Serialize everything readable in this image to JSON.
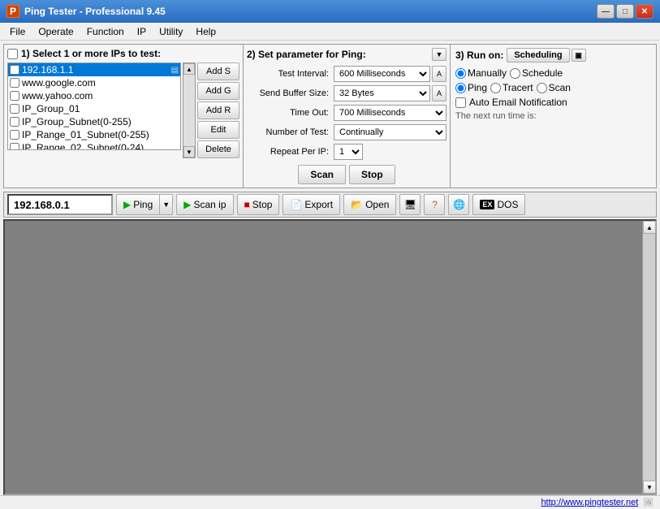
{
  "window": {
    "title": "Ping Tester - Professional  9.45",
    "icon": "PT"
  },
  "titlebar_controls": {
    "minimize": "—",
    "maximize": "□",
    "close": "✕"
  },
  "menubar": {
    "items": [
      "File",
      "Operate",
      "Function",
      "IP",
      "Utility",
      "Help"
    ]
  },
  "panel1": {
    "header": "1) Select 1 or more IPs to test:",
    "ips": [
      {
        "label": "192.168.1.1",
        "selected": true,
        "checked": false
      },
      {
        "label": "www.google.com",
        "selected": false,
        "checked": false
      },
      {
        "label": "www.yahoo.com",
        "selected": false,
        "checked": false
      },
      {
        "label": "IP_Group_01",
        "selected": false,
        "checked": false
      },
      {
        "label": "IP_Group_Subnet(0-255)",
        "selected": false,
        "checked": false
      },
      {
        "label": "IP_Range_01_Subnet(0-255)",
        "selected": false,
        "checked": false
      },
      {
        "label": "IP_Range_02_Subnet(0-24)",
        "selected": false,
        "checked": false
      }
    ],
    "buttons": [
      "Add S",
      "Add G",
      "Add R",
      "Edit",
      "Delete"
    ]
  },
  "panel2": {
    "header": "2) Set parameter for Ping:",
    "params": [
      {
        "label": "Test Interval:",
        "value": "600 Milliseconds"
      },
      {
        "label": "Send Buffer Size:",
        "value": "32 Bytes"
      },
      {
        "label": "Time Out:",
        "value": "700 Milliseconds"
      },
      {
        "label": "Number of Test:",
        "value": "Continually"
      },
      {
        "label": "Repeat Per IP:",
        "value": "1"
      }
    ],
    "scan_label": "Scan",
    "stop_label": "Stop"
  },
  "panel3": {
    "header": "3) Run on:",
    "scheduling_label": "Scheduling",
    "run_modes": {
      "manually": "Manually",
      "schedule": "Schedule"
    },
    "test_types": {
      "ping": "Ping",
      "tracert": "Tracert",
      "scan": "Scan"
    },
    "auto_email": "Auto Email Notification",
    "next_run_label": "The next run time is:"
  },
  "toolbar": {
    "ip_value": "192.168.0.1",
    "ping_label": "Ping",
    "scan_ip_label": "Scan ip",
    "stop_label": "Stop",
    "export_label": "Export",
    "open_label": "Open",
    "dos_label": "DOS"
  },
  "statusbar": {
    "url": "http://www.pingtester.net"
  }
}
